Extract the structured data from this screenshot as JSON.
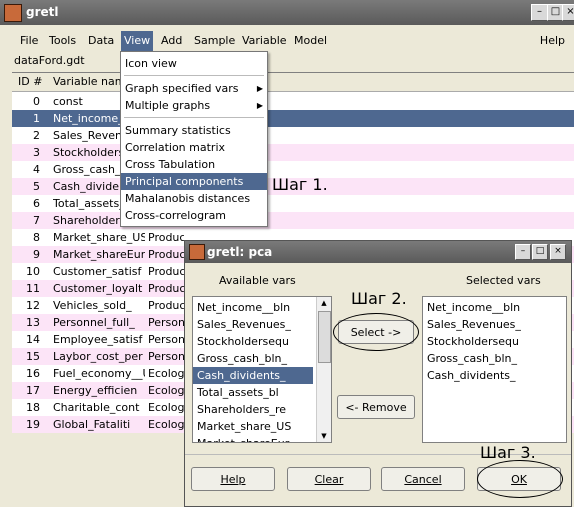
{
  "window": {
    "title": "gretl",
    "min": "–",
    "max": "□",
    "close": "×"
  },
  "menubar": [
    {
      "label": "File"
    },
    {
      "label": "Tools"
    },
    {
      "label": "Data"
    },
    {
      "label": "View"
    },
    {
      "label": "Add"
    },
    {
      "label": "Sample"
    },
    {
      "label": "Variable"
    },
    {
      "label": "Model"
    },
    {
      "label": "Help"
    }
  ],
  "filename": "dataFord.gdt",
  "list": {
    "headers": {
      "id": "ID #",
      "name": "Variable name"
    },
    "rows": [
      {
        "id": "0",
        "name": "const",
        "desc": ""
      },
      {
        "id": "1",
        "name": "Net_income_",
        "desc": ""
      },
      {
        "id": "2",
        "name": "Sales_Revenu",
        "desc": ""
      },
      {
        "id": "3",
        "name": "Stockholderse",
        "desc": ""
      },
      {
        "id": "4",
        "name": "Gross_cash_b",
        "desc": ""
      },
      {
        "id": "5",
        "name": "Cash_dividen",
        "desc": ""
      },
      {
        "id": "6",
        "name": "Total_assets_",
        "desc": ""
      },
      {
        "id": "7",
        "name": "Shareholders_",
        "desc": ""
      },
      {
        "id": "8",
        "name": "Market_share_US",
        "desc": "Product"
      },
      {
        "id": "9",
        "name": "Market_shareEur",
        "desc": "Product"
      },
      {
        "id": "10",
        "name": "Customer_satisf",
        "desc": "Product"
      },
      {
        "id": "11",
        "name": "Customer_loyalt",
        "desc": "Product"
      },
      {
        "id": "12",
        "name": "Vehicles_sold_",
        "desc": "Product"
      },
      {
        "id": "13",
        "name": "Personnel_full_",
        "desc": "Person"
      },
      {
        "id": "14",
        "name": "Employee_satisf",
        "desc": "Person"
      },
      {
        "id": "15",
        "name": "Laybor_cost_per",
        "desc": "Person"
      },
      {
        "id": "16",
        "name": "Fuel_economy__U",
        "desc": "Ecology"
      },
      {
        "id": "17",
        "name": "Energy_efficien",
        "desc": "Ecology"
      },
      {
        "id": "18",
        "name": "Charitable_cont",
        "desc": "Ecology"
      },
      {
        "id": "19",
        "name": "Global_Fataliti",
        "desc": "Ecology"
      }
    ]
  },
  "view_menu": {
    "items": [
      {
        "label": "Icon view"
      },
      {
        "label": "Graph specified vars"
      },
      {
        "label": "Multiple graphs"
      },
      {
        "label": "Summary statistics"
      },
      {
        "label": "Correlation matrix"
      },
      {
        "label": "Cross Tabulation"
      },
      {
        "label": "Principal components"
      },
      {
        "label": "Mahalanobis distances"
      },
      {
        "label": "Cross-correlogram"
      }
    ],
    "submenu_arrow": "▶"
  },
  "annotations": {
    "step1": "Шаг 1.",
    "step2": "Шаг 2.",
    "step3": "Шаг 3."
  },
  "dialog": {
    "title": "gretl: pca",
    "available_label": "Available vars",
    "selected_label": "Selected vars",
    "available": [
      "Net_income__bln",
      "Sales_Revenues_",
      "Stockholdersequ",
      "Gross_cash_bln_",
      "Cash_dividents_",
      "Total_assets_bl",
      "Shareholders_re",
      "Market_share_US",
      "Market_shareEur"
    ],
    "selected": [
      "Net_income__bln",
      "Sales_Revenues_",
      "Stockholdersequ",
      "Gross_cash_bln_",
      "Cash_dividents_"
    ],
    "select_btn": "Select ->",
    "remove_btn": "<- Remove",
    "help_btn": "Help",
    "clear_btn": "Clear",
    "cancel_btn": "Cancel",
    "ok_btn": "OK",
    "scroll_up": "▲",
    "scroll_down": "▼"
  },
  "colors": {
    "selection": "#4e6890",
    "alt_row": "#fce4f7"
  }
}
